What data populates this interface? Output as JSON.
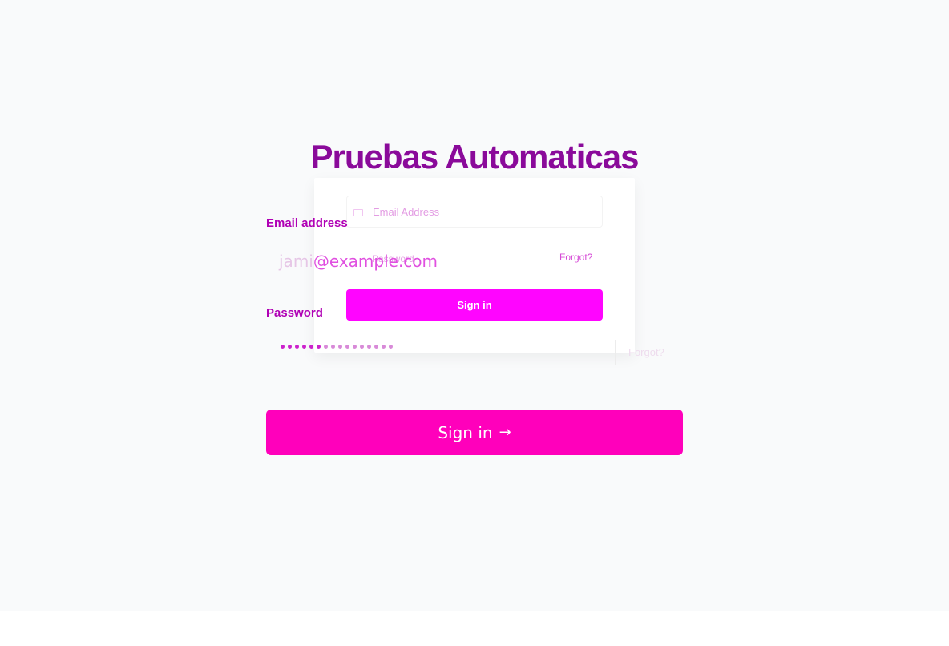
{
  "title": "Pruebas Automaticas",
  "overlay_card": {
    "email_placeholder": "Email Address",
    "password_placeholder": "Password",
    "forgot_label": "Forgot?",
    "signin_label": "Sign in"
  },
  "form": {
    "email_label": "Email address",
    "email_value_start": "jami",
    "email_value_end": "@example.com",
    "password_label": "Password",
    "forgot_label": "Forgot?",
    "signin_label": "Sign in",
    "arrow_icon": "arrow-right-icon"
  },
  "colors": {
    "title": "#8a0a9a",
    "label": "#b000b5",
    "primary_button": "#ff00bb",
    "overlay_button": "#ff05ff",
    "background": "#f9fafb"
  }
}
